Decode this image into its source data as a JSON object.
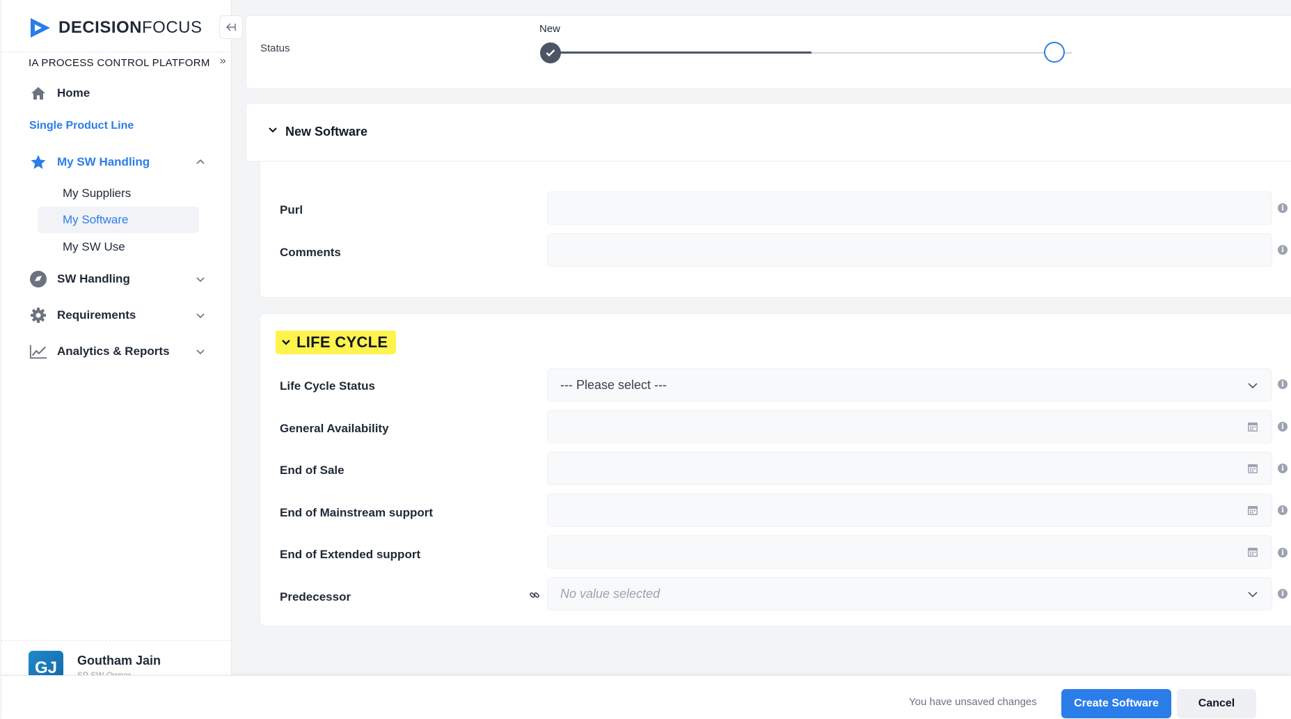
{
  "app": {
    "logo_bold": "DECISION",
    "logo_light": "FOCUS",
    "platform": "IA PROCESS CONTROL PLATFORM"
  },
  "sidebar": {
    "home": "Home",
    "section": "Single Product Line",
    "my_sw_handling": "My SW Handling",
    "sub_items": [
      "My Suppliers",
      "My Software",
      "My SW Use"
    ],
    "sw_handling": "SW Handling",
    "requirements": "Requirements",
    "analytics": "Analytics & Reports"
  },
  "user": {
    "initials": "GJ",
    "name": "Goutham Jain",
    "role": "SP SW Owner"
  },
  "status": {
    "label": "Status",
    "current_step": "New"
  },
  "new_software": {
    "title": "New Software",
    "fields": {
      "purl": "Purl",
      "comments": "Comments"
    }
  },
  "life_cycle": {
    "title": "LIFE CYCLE",
    "status_label": "Life Cycle Status",
    "status_value": "--- Please select ---",
    "general_availability": "General Availability",
    "end_of_sale": "End of Sale",
    "end_mainstream": "End of Mainstream support",
    "end_extended": "End of Extended support",
    "predecessor_label": "Predecessor",
    "predecessor_value": "No value selected"
  },
  "footer": {
    "unsaved": "You have unsaved changes",
    "create": "Create Software",
    "cancel": "Cancel"
  },
  "colors": {
    "accent": "#2b7de9",
    "highlight": "#fff34d"
  }
}
